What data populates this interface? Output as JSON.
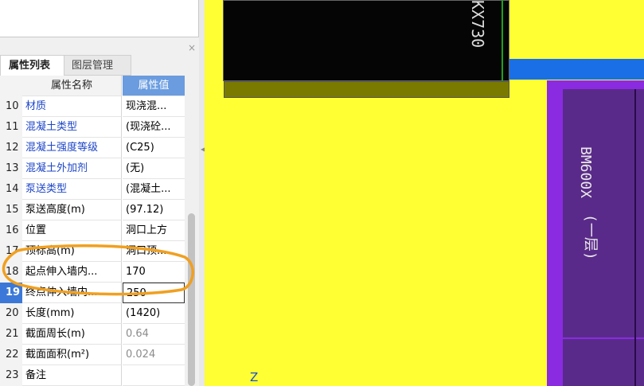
{
  "panel": {
    "close_glyph": "×",
    "tabs": [
      {
        "label": "属性列表",
        "active": true
      },
      {
        "label": "图层管理",
        "active": false
      }
    ],
    "header": {
      "name": "属性名称",
      "value": "属性值"
    },
    "rows": [
      {
        "num": "10",
        "name": "材质",
        "value": "现浇混...",
        "style": "blue"
      },
      {
        "num": "11",
        "name": "混凝土类型",
        "value": "(现浇砼...",
        "style": "blue"
      },
      {
        "num": "12",
        "name": "混凝土强度等级",
        "value": "(C25)",
        "style": "blue"
      },
      {
        "num": "13",
        "name": "混凝土外加剂",
        "value": "(无)",
        "style": "blue"
      },
      {
        "num": "14",
        "name": "泵送类型",
        "value": "(混凝土...",
        "style": "blue"
      },
      {
        "num": "15",
        "name": "泵送高度(m)",
        "value": "(97.12)",
        "style": "normal"
      },
      {
        "num": "16",
        "name": "位置",
        "value": "洞口上方",
        "style": "normal"
      },
      {
        "num": "17",
        "name": "顶标高(m)",
        "value": "洞口顶...",
        "style": "normal"
      },
      {
        "num": "18",
        "name": "起点伸入墙内...",
        "value": "170",
        "style": "normal"
      },
      {
        "num": "19",
        "name": "终点伸入墙内...",
        "value": "250",
        "style": "selected"
      },
      {
        "num": "20",
        "name": "长度(mm)",
        "value": "(1420)",
        "style": "normal"
      },
      {
        "num": "21",
        "name": "截面周长(m)",
        "value": "0.64",
        "style": "gray"
      },
      {
        "num": "22",
        "name": "截面面积(m²)",
        "value": "0.024",
        "style": "gray"
      },
      {
        "num": "23",
        "name": "备注",
        "value": "",
        "style": "normal"
      }
    ]
  },
  "canvas": {
    "label_top": "KX730",
    "label_right_1": "BM600X",
    "label_right_2": "(一层)",
    "axis_label": "Z"
  },
  "colors": {
    "canvas_bg": "#ffff33",
    "wall_black": "#050505",
    "beam_olive": "#7a7a00",
    "beam_blue": "#1a6fe6",
    "purple_frame": "#8a2be2",
    "purple_fill": "#5a2a8a",
    "highlight_orange": "#f0a020",
    "tab_header_blue": "#6a9cdf",
    "row_selected_blue": "#3c78d8",
    "link_blue": "#1e46c8"
  }
}
